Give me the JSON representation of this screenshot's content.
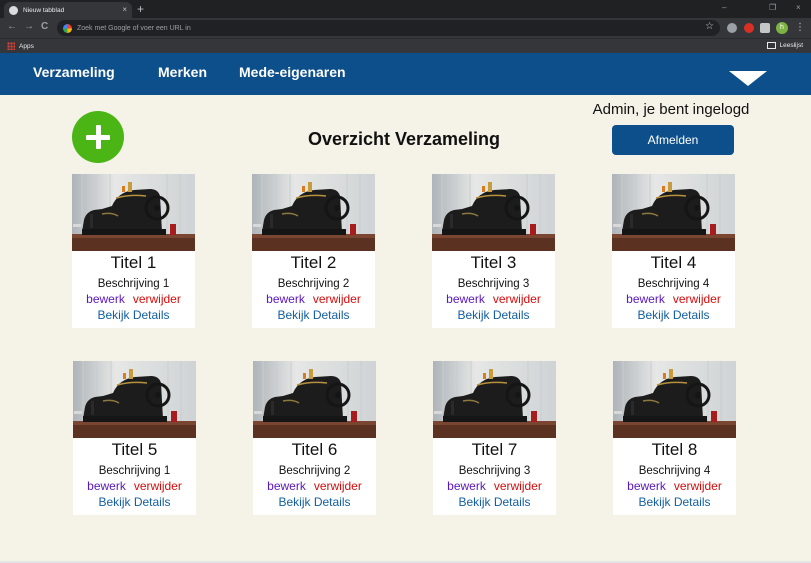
{
  "browser": {
    "tab_title": "Nieuw tabblad",
    "tab_close": "×",
    "new_tab": "+",
    "window_min": "–",
    "window_max": "❐",
    "window_close": "×",
    "back": "←",
    "forward": "→",
    "reload": "C",
    "omnibox_placeholder": "Zoek met Google of voer een URL in",
    "star": "☆",
    "profile_initial": "h",
    "menu": "⋮",
    "bookmarks_apps": "Apps",
    "reading_list": "Leeslijst"
  },
  "nav": {
    "items": [
      {
        "label": "Verzameling"
      },
      {
        "label": "Merken"
      },
      {
        "label": "Mede-eigenaren"
      }
    ]
  },
  "header": {
    "title": "Overzicht Verzameling",
    "login_status": "Admin, je bent ingelogd",
    "logout_label": "Afmelden"
  },
  "cards": [
    {
      "title": "Titel 1",
      "description": "Beschrijving 1",
      "edit": "bewerk",
      "delete": "verwijder",
      "details": "Bekijk Details"
    },
    {
      "title": "Titel 2",
      "description": "Beschrijving 2",
      "edit": "bewerk",
      "delete": "verwijder",
      "details": "Bekijk Details"
    },
    {
      "title": "Titel 3",
      "description": "Beschrijving 3",
      "edit": "bewerk",
      "delete": "verwijder",
      "details": "Bekijk Details"
    },
    {
      "title": "Titel 4",
      "description": "Beschrijving 4",
      "edit": "bewerk",
      "delete": "verwijder",
      "details": "Bekijk Details"
    },
    {
      "title": "Titel 5",
      "description": "Beschrijving 1",
      "edit": "bewerk",
      "delete": "verwijder",
      "details": "Bekijk Details"
    },
    {
      "title": "Titel 6",
      "description": "Beschrijving 2",
      "edit": "bewerk",
      "delete": "verwijder",
      "details": "Bekijk Details"
    },
    {
      "title": "Titel 7",
      "description": "Beschrijving 3",
      "edit": "bewerk",
      "delete": "verwijder",
      "details": "Bekijk Details"
    },
    {
      "title": "Titel 8",
      "description": "Beschrijving 4",
      "edit": "bewerk",
      "delete": "verwijder",
      "details": "Bekijk Details"
    }
  ],
  "colors": {
    "nav_background": "#0d4f8b",
    "page_background": "#f5f3e7",
    "add_button": "#4bb516",
    "edit_link": "#5a16b8",
    "delete_link": "#d40c0c",
    "details_link": "#135fa0"
  },
  "icons": {
    "add": "plus-icon",
    "nav_toggle": "chevron-down-icon",
    "card_image": "sewing-machine-image"
  }
}
